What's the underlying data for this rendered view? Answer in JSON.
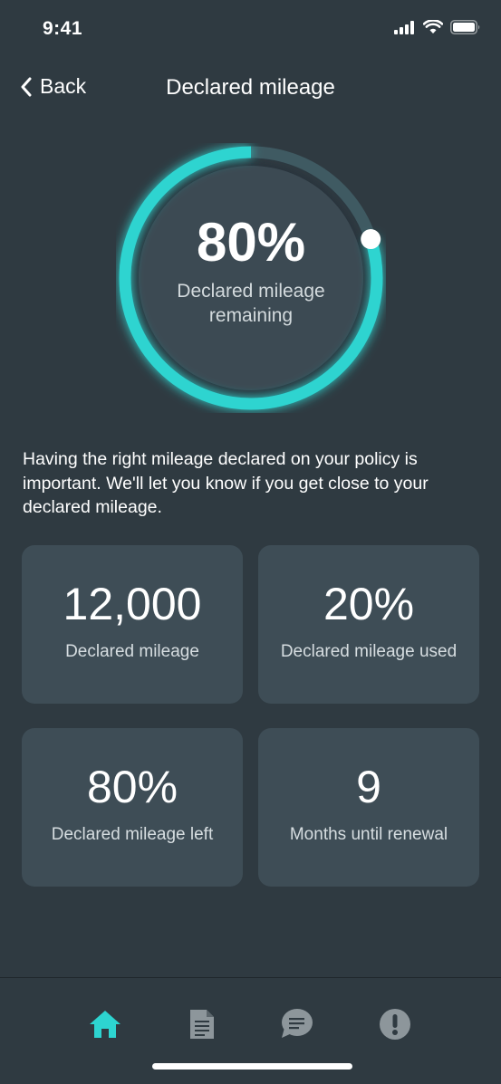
{
  "status_bar": {
    "time": "9:41"
  },
  "nav": {
    "back_label": "Back",
    "title": "Declared mileage"
  },
  "gauge": {
    "value": "80%",
    "label": "Declared mileage remaining",
    "fraction": 0.8
  },
  "description": "Having the right mileage declared on your policy is important. We'll let you know if you get close to your declared mileage.",
  "stats": [
    {
      "value": "12,000",
      "label": "Declared mileage"
    },
    {
      "value": "20%",
      "label": "Declared mileage used"
    },
    {
      "value": "80%",
      "label": "Declared mileage left"
    },
    {
      "value": "9",
      "label": "Months until renewal"
    }
  ],
  "tab_bar": {
    "tabs": [
      {
        "icon": "home-icon",
        "active": true
      },
      {
        "icon": "document-icon",
        "active": false
      },
      {
        "icon": "chat-icon",
        "active": false
      },
      {
        "icon": "alert-icon",
        "active": false
      }
    ]
  },
  "colors": {
    "background": "#2f3a41",
    "accent": "#2dd4d0",
    "card": "#3e4d56",
    "inactive_icon": "#8d969b"
  }
}
